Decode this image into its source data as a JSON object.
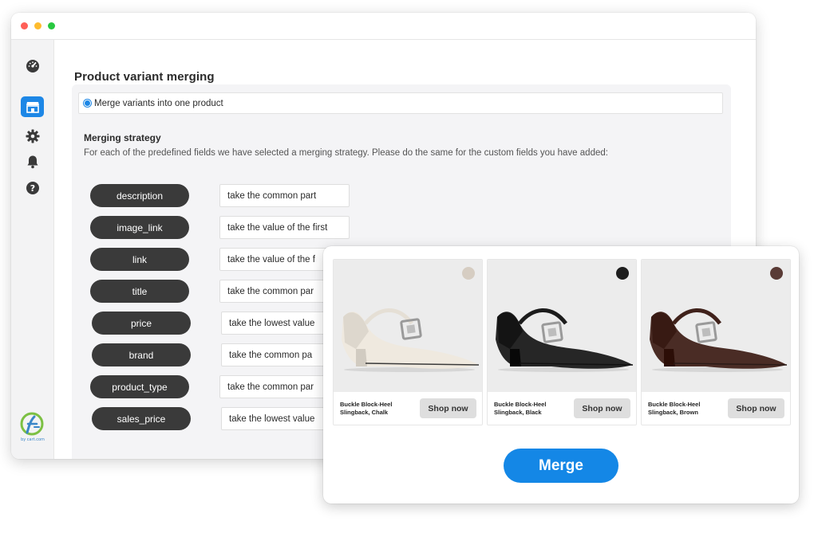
{
  "window": {
    "title_dots": [
      "close",
      "minimize",
      "maximize"
    ]
  },
  "sidebar": {
    "items": [
      {
        "icon": "dashboard-gauge-icon",
        "active": false
      },
      {
        "icon": "store-icon",
        "active": true
      },
      {
        "icon": "gear-icon",
        "active": false
      },
      {
        "icon": "bell-icon",
        "active": false
      },
      {
        "icon": "help-icon",
        "active": false
      }
    ],
    "logo_caption": "by cart.com"
  },
  "page": {
    "title": "Product variant merging",
    "radio_label": "Merge variants into one product",
    "strategy_title": "Merging strategy",
    "strategy_description": "For each of the predefined fields we have selected a merging strategy. Please do the same for the custom fields you have added:"
  },
  "fields": [
    {
      "name": "description",
      "strategy": "take the common part"
    },
    {
      "name": "image_link",
      "strategy": "take the value of the first"
    },
    {
      "name": "link",
      "strategy": "take the value of the f"
    },
    {
      "name": "title",
      "strategy": "take the common par"
    },
    {
      "name": "price",
      "strategy": "take the lowest value"
    },
    {
      "name": "brand",
      "strategy": "take the common pa"
    },
    {
      "name": "product_type",
      "strategy": "take the common par"
    },
    {
      "name": "sales_price",
      "strategy": "take the lowest value"
    }
  ],
  "products": [
    {
      "name": "Buckle Block-Heel Slingback, Chalk",
      "button": "Shop now",
      "swatch_color": "#d6cdc2",
      "shoe_color": "#efe9df"
    },
    {
      "name": "Buckle Block-Heel Slingback, Black",
      "button": "Shop now",
      "swatch_color": "#1e1e1e",
      "shoe_color": "#262626"
    },
    {
      "name": "Buckle Block-Heel Slingback, Brown",
      "button": "Shop now",
      "swatch_color": "#5a3b36",
      "shoe_color": "#4a2c25"
    }
  ],
  "merge_button": "Merge",
  "colors": {
    "accent": "#1d87e6",
    "pill": "#3a3a3a"
  }
}
